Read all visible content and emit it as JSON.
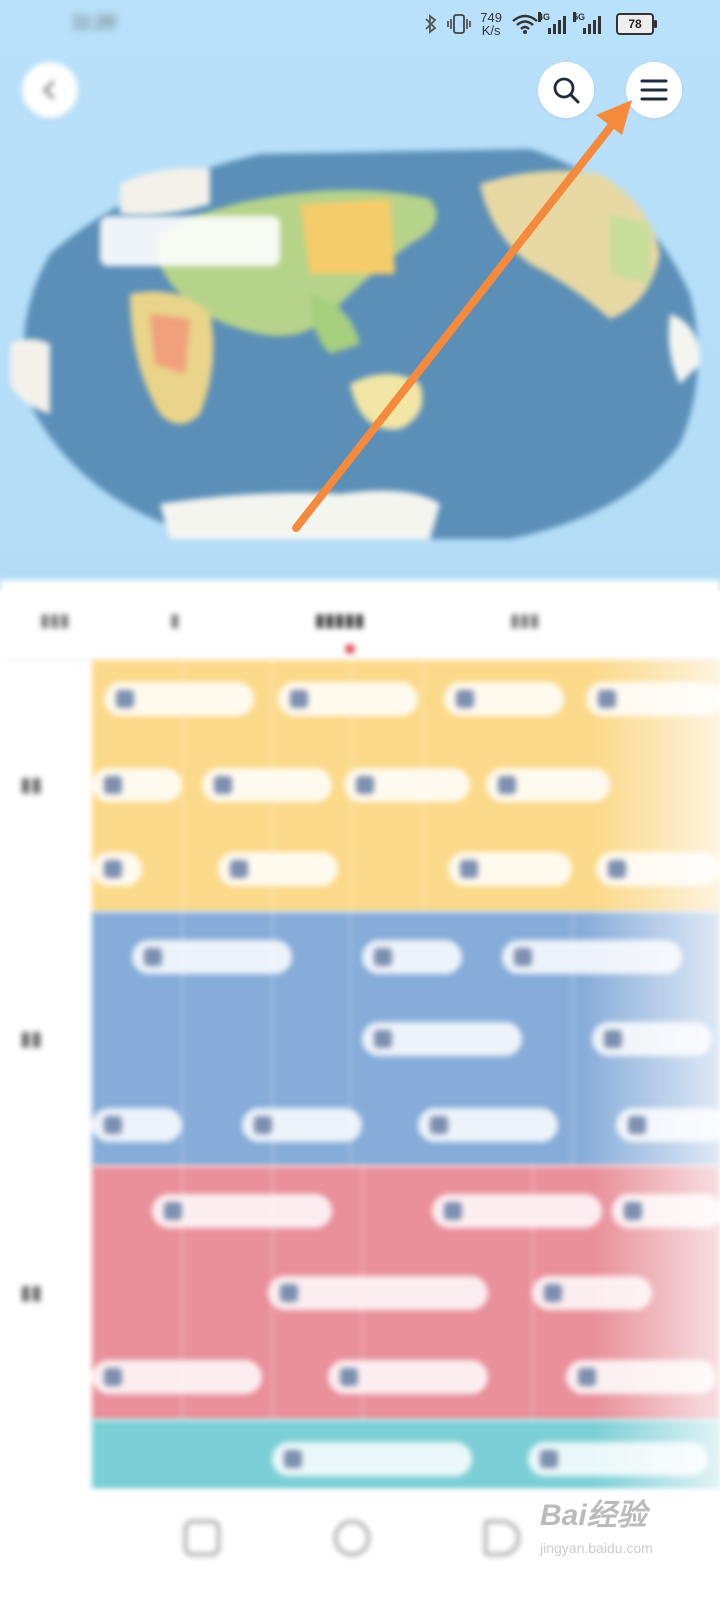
{
  "status_bar": {
    "net_speed_value": "749",
    "net_speed_unit": "K/s",
    "signal_1_label": "4G",
    "signal_2_label": "5G",
    "battery": "78"
  },
  "icons": {
    "back": "chevron-left-icon",
    "search": "search-icon",
    "menu": "hamburger-menu-icon",
    "annotation": "orange-arrow-pointing-to-menu"
  },
  "colors": {
    "sky": "#b9e1fb",
    "ocean": "#5b8fb8",
    "annotation_arrow": "#f58a3c",
    "band_yellow": "#fbd98a",
    "band_blue": "#86acd9",
    "band_red": "#e9909a",
    "band_teal": "#7ccfd6"
  },
  "watermark": {
    "brand": "Bai经验",
    "url": "jingyan.baidu.com"
  }
}
